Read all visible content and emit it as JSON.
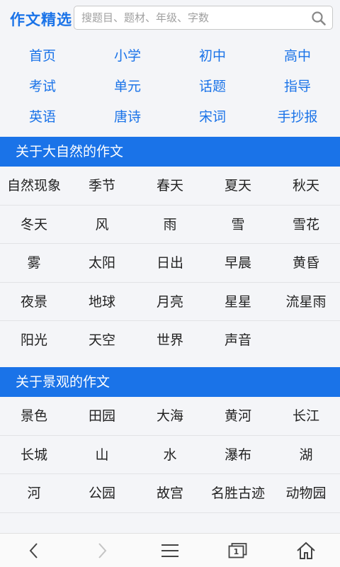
{
  "header": {
    "logo": "作文精选",
    "search_placeholder": "搜题目、题材、年级、字数"
  },
  "nav": {
    "items": [
      "首页",
      "小学",
      "初中",
      "高中",
      "考试",
      "单元",
      "话题",
      "指导",
      "英语",
      "唐诗",
      "宋词",
      "手抄报"
    ]
  },
  "sections": [
    {
      "title": "关于大自然的作文",
      "items": [
        "自然现象",
        "季节",
        "春天",
        "夏天",
        "秋天",
        "冬天",
        "风",
        "雨",
        "雪",
        "雪花",
        "雾",
        "太阳",
        "日出",
        "早晨",
        "黄昏",
        "夜景",
        "地球",
        "月亮",
        "星星",
        "流星雨",
        "阳光",
        "天空",
        "世界",
        "声音"
      ]
    },
    {
      "title": "关于景观的作文",
      "items": [
        "景色",
        "田园",
        "大海",
        "黄河",
        "长江",
        "长城",
        "山",
        "水",
        "瀑布",
        "湖",
        "河",
        "公园",
        "故宫",
        "名胜古迹",
        "动物园"
      ]
    }
  ],
  "bottom_bar": {
    "icons": [
      "back-icon",
      "forward-icon",
      "menu-icon",
      "tabs-icon",
      "home-icon"
    ],
    "tab_count": "1"
  },
  "colors": {
    "accent": "#1a73e8",
    "background": "#f4f5f8"
  }
}
